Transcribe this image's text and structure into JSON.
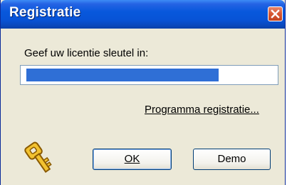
{
  "window": {
    "title": "Registratie",
    "close_icon": "close-icon"
  },
  "form": {
    "prompt_label": "Geef uw licentie sleutel in:",
    "license_key_value": "",
    "register_link": "Programma registratie..."
  },
  "buttons": {
    "ok_label": "OK",
    "demo_label": "Demo"
  },
  "icons": {
    "key": "key-icon"
  },
  "colors": {
    "titlebar": "#0858dc",
    "selection": "#2f6fd6",
    "close": "#d65530",
    "dialog_bg": "#ece9d8"
  }
}
